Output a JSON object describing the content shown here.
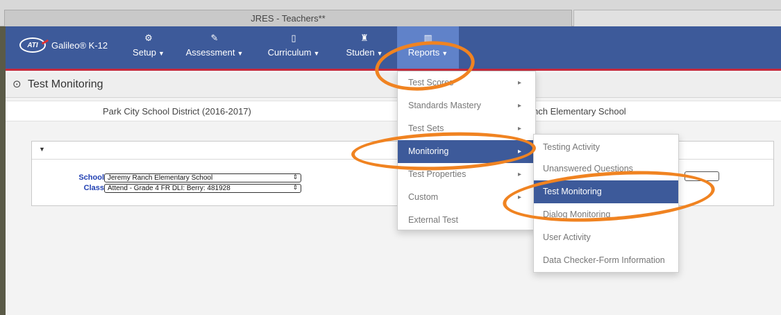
{
  "browser": {
    "tab_title": "JRES - Teachers**"
  },
  "brand": {
    "logo_text": "ATI",
    "app_name": "Galileo® K-12"
  },
  "nav": {
    "items": [
      {
        "label": "Setup",
        "icon": "gear-icon",
        "glyph": "⚙"
      },
      {
        "label": "Assessment",
        "icon": "edit-icon",
        "glyph": "✎"
      },
      {
        "label": "Curriculum",
        "icon": "book-icon",
        "glyph": "▯"
      },
      {
        "label": "Studen",
        "icon": "student-icon",
        "glyph": "♜"
      },
      {
        "label": "Reports",
        "icon": "bar-chart-icon",
        "glyph": "▥"
      }
    ]
  },
  "page": {
    "title": "Test Monitoring"
  },
  "district": {
    "name": "Park City School District (2016-2017)",
    "school": "nch Elementary School"
  },
  "filters": {
    "school_label": "School",
    "school_value": "Jeremy Ranch Elementary School",
    "class_label": "Class",
    "class_value": "Attend - Grade 4 FR DLI: Berry: 481928"
  },
  "reports_menu": {
    "items": [
      {
        "label": "Test Scores"
      },
      {
        "label": "Standards Mastery"
      },
      {
        "label": "Test Sets"
      },
      {
        "label": "Monitoring"
      },
      {
        "label": "Test Properties"
      },
      {
        "label": "Custom"
      },
      {
        "label": "External Test"
      }
    ]
  },
  "monitoring_submenu": {
    "items": [
      {
        "label": "Testing Activity"
      },
      {
        "label": "Unanswered Questions"
      },
      {
        "label": "Test Monitoring"
      },
      {
        "label": "Dialog Monitoring"
      },
      {
        "label": "User Activity"
      },
      {
        "label": "Data Checker-Form Information"
      }
    ]
  },
  "colors": {
    "nav_bg": "#3d5a9a",
    "active_item": "#3d5a9a",
    "accent_red": "#c7293b",
    "annotation": "#f08321"
  }
}
